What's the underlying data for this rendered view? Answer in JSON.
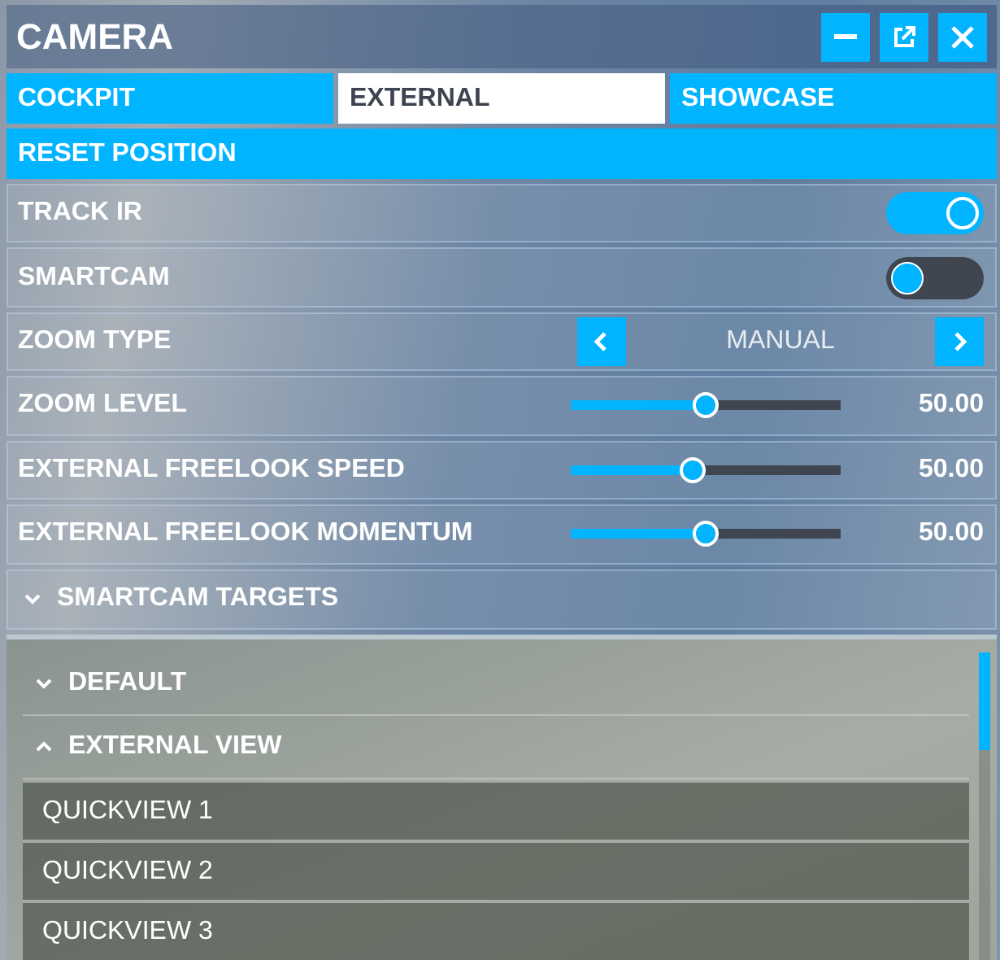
{
  "window": {
    "title": "CAMERA"
  },
  "tabs": [
    {
      "label": "COCKPIT",
      "selected": false
    },
    {
      "label": "EXTERNAL",
      "selected": true
    },
    {
      "label": "SHOWCASE",
      "selected": false
    }
  ],
  "reset_button": {
    "label": "RESET POSITION"
  },
  "settings": [
    {
      "kind": "toggle",
      "label": "TRACK IR",
      "on": true
    },
    {
      "kind": "toggle",
      "label": "SMARTCAM",
      "on": false
    },
    {
      "kind": "stepper",
      "label": "ZOOM TYPE",
      "value": "MANUAL"
    },
    {
      "kind": "slider",
      "label": "ZOOM LEVEL",
      "level": 0.5,
      "reading": "50.00"
    },
    {
      "kind": "slider",
      "label": "EXTERNAL FREELOOK SPEED",
      "level": 0.45,
      "reading": "50.00"
    },
    {
      "kind": "slider",
      "label": "EXTERNAL FREELOOK MOMENTUM",
      "level": 0.5,
      "reading": "50.00"
    }
  ],
  "smartcam_targets": {
    "label": "SMARTCAM TARGETS",
    "expanded": false,
    "groups": [
      {
        "label": "DEFAULT",
        "expanded": false
      },
      {
        "label": "EXTERNAL VIEW",
        "expanded": true,
        "items": [
          "QUICKVIEW 1",
          "QUICKVIEW 2",
          "QUICKVIEW 3"
        ]
      }
    ]
  }
}
